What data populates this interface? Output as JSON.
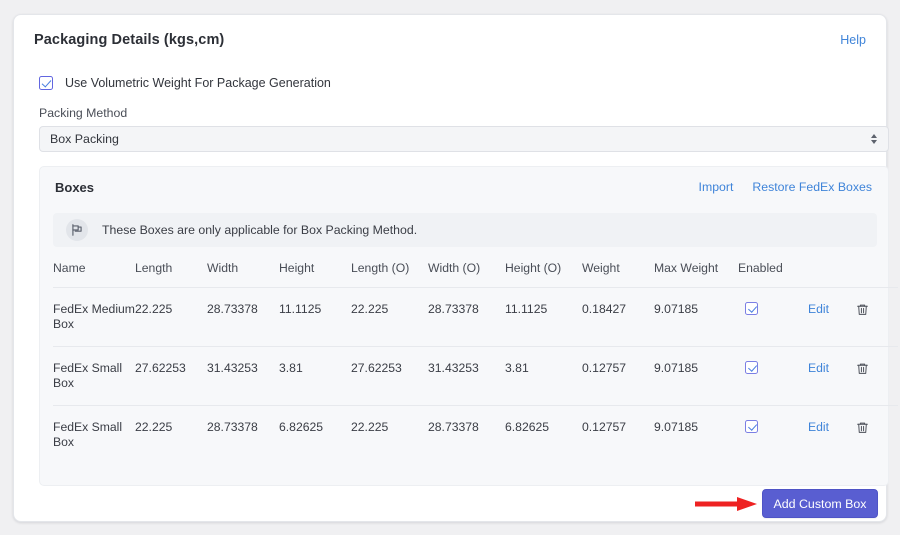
{
  "card": {
    "title": "Packaging Details (kgs,cm)",
    "help_label": "Help"
  },
  "volumetric": {
    "label": "Use Volumetric Weight For Package Generation",
    "checked": true
  },
  "packing_method": {
    "label": "Packing Method",
    "value": "Box Packing",
    "options": [
      "Box Packing"
    ]
  },
  "boxes": {
    "title": "Boxes",
    "import_label": "Import",
    "restore_label": "Restore FedEx Boxes",
    "info_text": "These Boxes are only applicable for Box Packing Method.",
    "info_icon": "flag-icon",
    "columns": [
      "Name",
      "Length",
      "Width",
      "Height",
      "Length (O)",
      "Width (O)",
      "Height (O)",
      "Weight",
      "Max Weight",
      "Enabled"
    ],
    "rows": [
      {
        "name": "FedEx Medium Box",
        "length": "22.225",
        "width": "28.73378",
        "height": "11.1125",
        "length_o": "22.225",
        "width_o": "28.73378",
        "height_o": "11.1125",
        "weight": "0.18427",
        "max_weight": "9.07185",
        "enabled": true,
        "edit_label": "Edit",
        "delete_icon": "trash-icon"
      },
      {
        "name": "FedEx Small Box",
        "length": "27.62253",
        "width": "31.43253",
        "height": "3.81",
        "length_o": "27.62253",
        "width_o": "31.43253",
        "height_o": "3.81",
        "weight": "0.12757",
        "max_weight": "9.07185",
        "enabled": true,
        "edit_label": "Edit",
        "delete_icon": "trash-icon"
      },
      {
        "name": "FedEx Small Box",
        "length": "22.225",
        "width": "28.73378",
        "height": "6.82625",
        "length_o": "22.225",
        "width_o": "28.73378",
        "height_o": "6.82625",
        "weight": "0.12757",
        "max_weight": "9.07185",
        "enabled": true,
        "edit_label": "Edit",
        "delete_icon": "trash-icon"
      }
    ]
  },
  "footer": {
    "add_custom_box_label": "Add Custom Box"
  },
  "annotation": {
    "arrow_icon": "red-arrow-right",
    "arrow_color": "#ee2222"
  },
  "colors": {
    "accent_button": "#595ed1",
    "link": "#3f84d9",
    "checkbox_border": "#6266e0",
    "page_background": "#f0f0f2",
    "panel_background": "#f7f8fa"
  }
}
